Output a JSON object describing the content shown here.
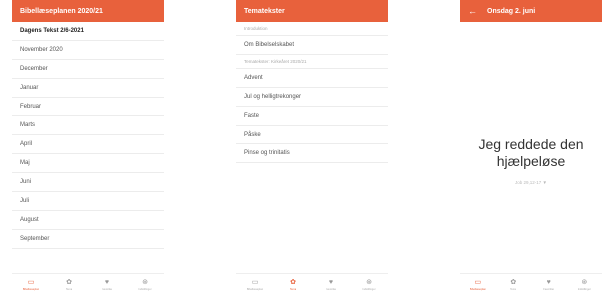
{
  "screen1": {
    "title": "Bibellæseplanen 2020/21",
    "rows": [
      "Dagens Tekst 2/6-2021",
      "November 2020",
      "December",
      "Januar",
      "Februar",
      "Marts",
      "April",
      "Maj",
      "Juni",
      "Juli",
      "August",
      "September"
    ],
    "tabs": [
      "Bibellæseplan",
      "Tema",
      "Favoritter",
      "Indstillinger"
    ]
  },
  "screen2": {
    "title": "Tematekster",
    "section1": "Introduktion",
    "item1": "Om Bibelselskabet",
    "section2": "Tematekster: Kirkeåret 2020/21",
    "items": [
      "Advent",
      "Jul og helligtrekonger",
      "Faste",
      "Påske",
      "Pinse og trinitatis"
    ],
    "tabs": [
      "Bibellæseplan",
      "Tema",
      "Favoritter",
      "Indstillinger"
    ]
  },
  "screen3": {
    "title": "Onsdag 2. juni",
    "back_icon": "←",
    "verse_line1": "Jeg reddede den",
    "verse_line2": "hjælpeløse",
    "reference": "Job 29,12-17 ▼",
    "tabs": [
      "Bibellæseplan",
      "Tema",
      "Favoritter",
      "Indstillinger"
    ]
  },
  "icons": {
    "calendar": "▭",
    "gear": "✿",
    "heart": "♥",
    "settings": "⊛"
  },
  "colors": {
    "accent": "#e8613c"
  }
}
